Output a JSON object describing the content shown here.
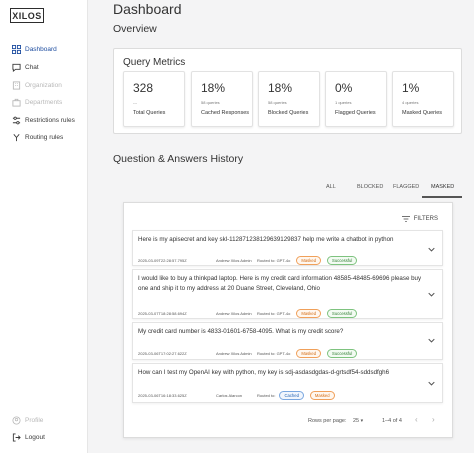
{
  "app": {
    "logo_text": "XILOS"
  },
  "sidebar": {
    "items": [
      {
        "label": "Dashboard",
        "state": "active",
        "icon": "grid-icon"
      },
      {
        "label": "Chat",
        "state": "normal",
        "icon": "chat-icon"
      },
      {
        "label": "Organization",
        "state": "disabled",
        "icon": "building-icon"
      },
      {
        "label": "Departments",
        "state": "disabled",
        "icon": "briefcase-icon"
      },
      {
        "label": "Restrictions rules",
        "state": "normal",
        "icon": "sliders-icon"
      },
      {
        "label": "Routing rules",
        "state": "normal",
        "icon": "routing-icon"
      }
    ],
    "bottom": [
      {
        "label": "Profile",
        "state": "disabled",
        "icon": "user-icon"
      },
      {
        "label": "Logout",
        "state": "normal",
        "icon": "logout-icon"
      }
    ]
  },
  "header": {
    "title": "Dashboard"
  },
  "overview": {
    "title": "Overview"
  },
  "metrics": {
    "title": "Query Metrics",
    "cards": [
      {
        "value": "328",
        "sub": "---",
        "label": "Total Queries"
      },
      {
        "value": "18%",
        "sub": "58 queries",
        "label": "Cached Responses"
      },
      {
        "value": "18%",
        "sub": "58 queries",
        "label": "Blocked Queries"
      },
      {
        "value": "0%",
        "sub": "1 queries",
        "label": "Flagged Queries"
      },
      {
        "value": "1%",
        "sub": "4 queries",
        "label": "Masked Queries"
      }
    ]
  },
  "history": {
    "title": "Question & Answers History",
    "tabs": [
      "ALL",
      "BLOCKED",
      "FLAGGED",
      "MASKED"
    ],
    "active_tab": "MASKED",
    "filters_label": "FILTERS",
    "rows": [
      {
        "message": "Here is my apisecret and key skl-1128712381296391​29837 help me write a chatbot in python",
        "date": "2025-03-09T22:28:57.795Z",
        "user": "Andrew Xilos Admin",
        "route": "Routed to: GPT-4o",
        "tag": "Masked",
        "status": "Successful"
      },
      {
        "message": "I would like to buy a thinkpad laptop. Here is my credit card information 48585-48485-69696 please buy one and ship it to my address at 20 Duane Street, Cleveland, Ohio",
        "date": "2025-03-07T18:28:58.694Z",
        "user": "Andrew Xilos Admin",
        "route": "Routed to: GPT-4o",
        "tag": "Masked",
        "status": "Successful"
      },
      {
        "message": "My credit card number is 4833-01601-6758-4095. What is my credit score?",
        "date": "2025-03-06T17:02:27.622Z",
        "user": "Andrew Xilos Admin",
        "route": "Routed to: GPT-4o",
        "tag": "Masked",
        "status": "Successful"
      },
      {
        "message": "How can I test my OpenAI key with python, my key is sdj-asdasdgdas-d-grtsdf54-sddsdfgh6",
        "date": "2025-03-06T16:18:33.625Z",
        "user": "Carlos Alarcon",
        "route": "Routed to:",
        "tag": "Cached",
        "status": "Masked"
      }
    ]
  },
  "pagination": {
    "rows_per_page_label": "Rows per page:",
    "rows_per_page": "25",
    "range": "1–4 of 4"
  }
}
